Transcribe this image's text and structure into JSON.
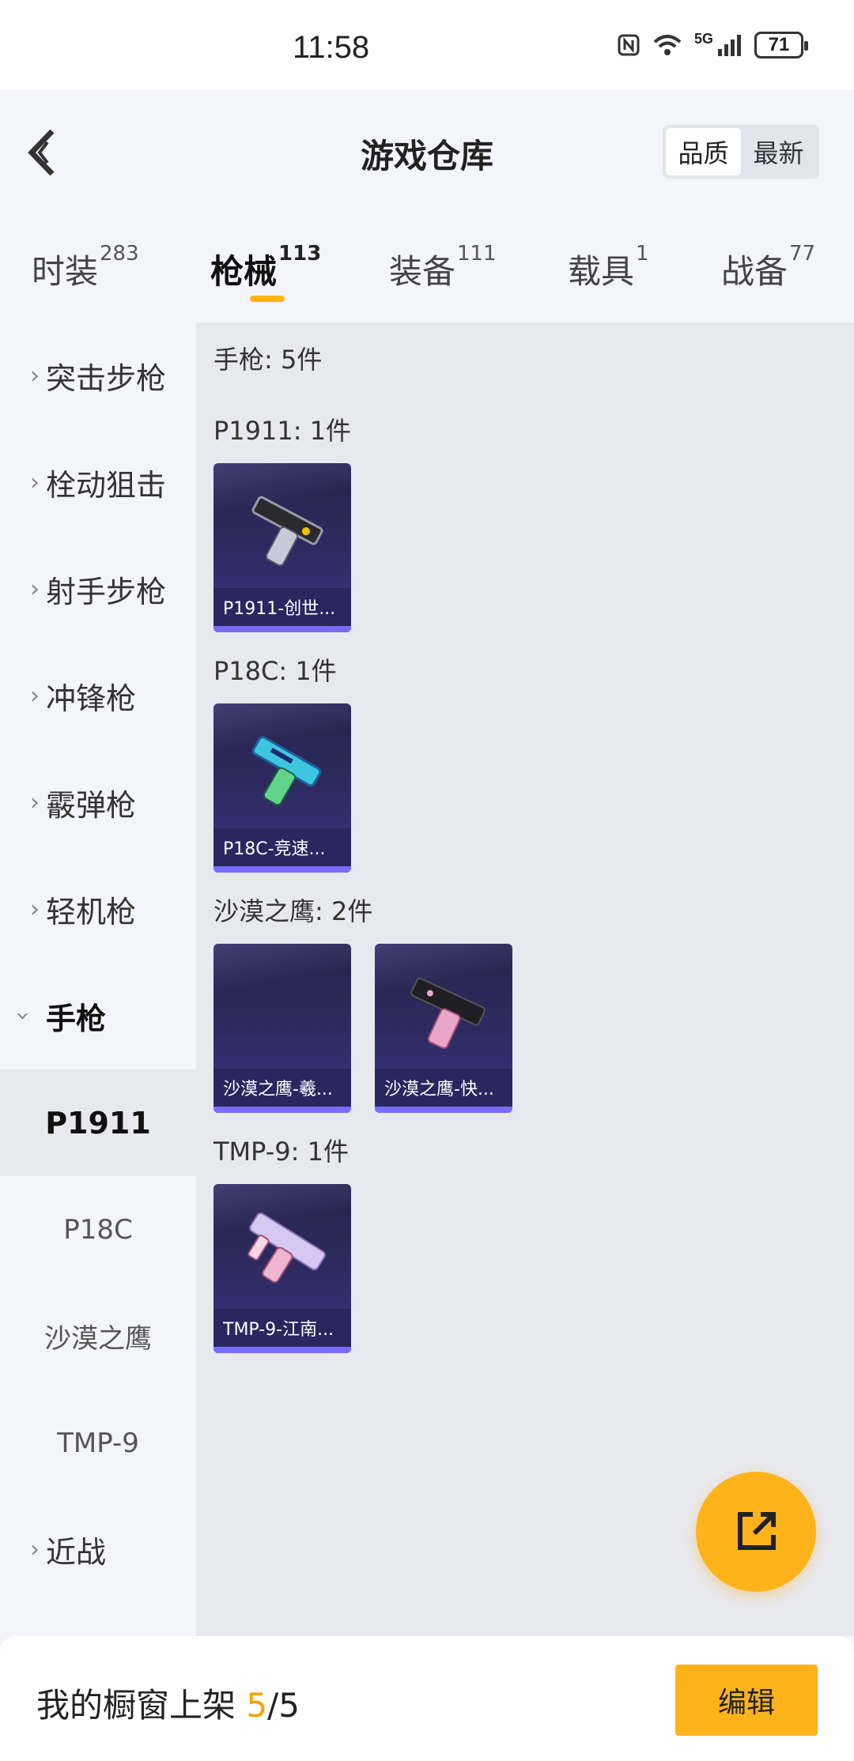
{
  "status_bar": {
    "time": "11:58",
    "network": "5G",
    "battery": "71"
  },
  "header": {
    "title": "游戏仓库",
    "sort_options": [
      "品质",
      "最新"
    ]
  },
  "tabs": [
    {
      "label": "时装",
      "count": "283"
    },
    {
      "label": "枪械",
      "count": "113"
    },
    {
      "label": "装备",
      "count": "111"
    },
    {
      "label": "载具",
      "count": "1"
    },
    {
      "label": "战备",
      "count": "77"
    }
  ],
  "sidebar": {
    "categories": [
      "突击步枪",
      "栓动狙击",
      "射手步枪",
      "冲锋枪",
      "霰弹枪",
      "轻机枪",
      "手枪"
    ],
    "pistol_subitems": [
      "P1911",
      "P18C",
      "沙漠之鹰",
      "TMP-9"
    ],
    "last_category": "近战"
  },
  "content": {
    "section_title": "手枪: 5件",
    "groups": [
      {
        "title": "P1911: 1件",
        "items": [
          "P1911-创世..."
        ]
      },
      {
        "title": "P18C: 1件",
        "items": [
          "P18C-竞速..."
        ]
      },
      {
        "title": "沙漠之鹰: 2件",
        "items": [
          "沙漠之鹰-羲...",
          "沙漠之鹰-快..."
        ]
      },
      {
        "title": "TMP-9: 1件",
        "items": [
          "TMP-9-江南..."
        ]
      }
    ]
  },
  "bottom": {
    "label": "我的橱窗上架 ",
    "current": "5",
    "total": "/5",
    "edit_label": "编辑"
  },
  "colors": {
    "accent": "#ffb31a",
    "card_bg": "#2f2b63",
    "card_stripe": "#7a6bff"
  }
}
